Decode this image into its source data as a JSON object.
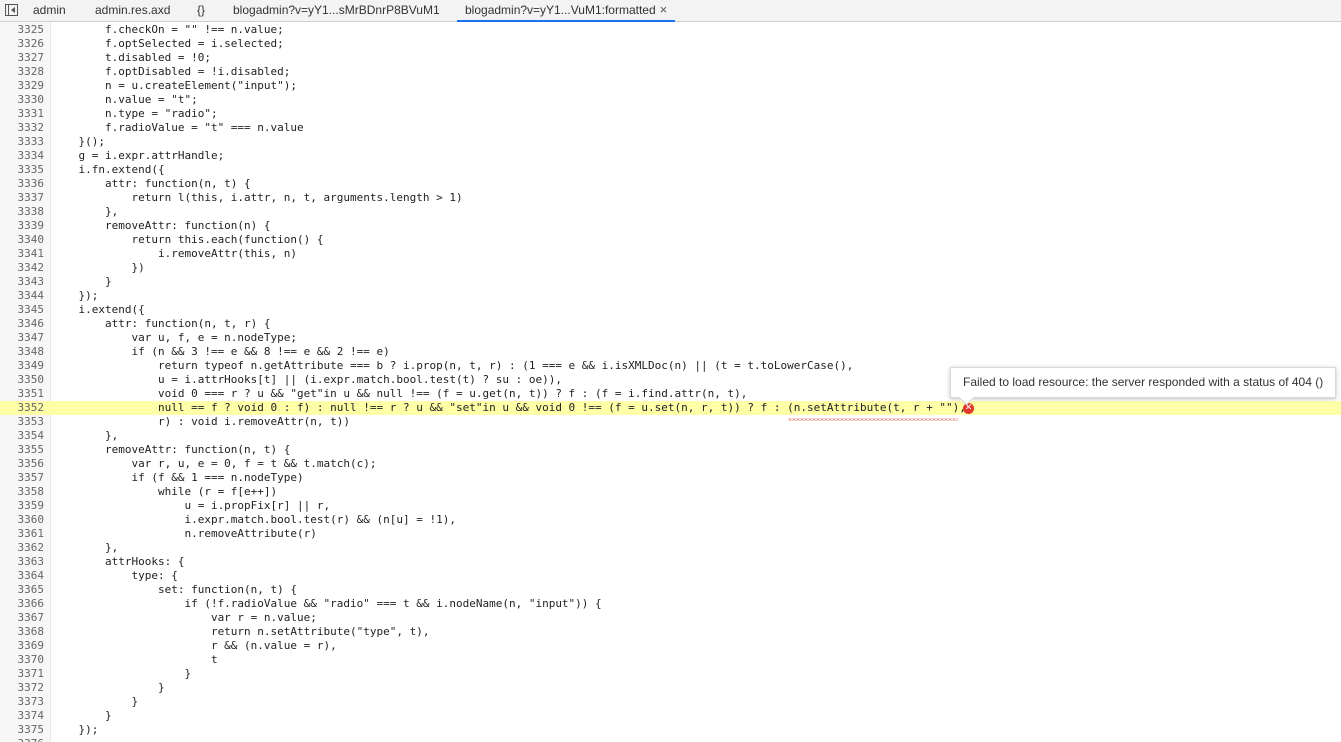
{
  "tabs": [
    {
      "label": "admin",
      "active": false
    },
    {
      "label": "admin.res.axd",
      "active": false
    },
    {
      "label": "{}",
      "active": false
    },
    {
      "label": "blogadmin?v=yY1...sMrBDnrP8BVuM1",
      "active": false
    },
    {
      "label": "blogadmin?v=yY1...VuM1:formatted",
      "active": true
    }
  ],
  "close_glyph": "×",
  "error": {
    "message": "Failed to load resource: the server responded with a status of 404 ()",
    "line": "3352"
  },
  "highlight_color": "#ffffa8",
  "error_color": "#e0392b",
  "lines": [
    {
      "n": "3325",
      "t": "        f.checkOn = \"\" !== n.value;"
    },
    {
      "n": "3326",
      "t": "        f.optSelected = i.selected;"
    },
    {
      "n": "3327",
      "t": "        t.disabled = !0;"
    },
    {
      "n": "3328",
      "t": "        f.optDisabled = !i.disabled;"
    },
    {
      "n": "3329",
      "t": "        n = u.createElement(\"input\");"
    },
    {
      "n": "3330",
      "t": "        n.value = \"t\";"
    },
    {
      "n": "3331",
      "t": "        n.type = \"radio\";"
    },
    {
      "n": "3332",
      "t": "        f.radioValue = \"t\" === n.value"
    },
    {
      "n": "3333",
      "t": "    }();"
    },
    {
      "n": "3334",
      "t": "    g = i.expr.attrHandle;"
    },
    {
      "n": "3335",
      "t": "    i.fn.extend({"
    },
    {
      "n": "3336",
      "t": "        attr: function(n, t) {"
    },
    {
      "n": "3337",
      "t": "            return l(this, i.attr, n, t, arguments.length > 1)"
    },
    {
      "n": "3338",
      "t": "        },"
    },
    {
      "n": "3339",
      "t": "        removeAttr: function(n) {"
    },
    {
      "n": "3340",
      "t": "            return this.each(function() {"
    },
    {
      "n": "3341",
      "t": "                i.removeAttr(this, n)"
    },
    {
      "n": "3342",
      "t": "            })"
    },
    {
      "n": "3343",
      "t": "        }"
    },
    {
      "n": "3344",
      "t": "    });"
    },
    {
      "n": "3345",
      "t": "    i.extend({"
    },
    {
      "n": "3346",
      "t": "        attr: function(n, t, r) {"
    },
    {
      "n": "3347",
      "t": "            var u, f, e = n.nodeType;"
    },
    {
      "n": "3348",
      "t": "            if (n && 3 !== e && 8 !== e && 2 !== e)"
    },
    {
      "n": "3349",
      "t": "                return typeof n.getAttribute === b ? i.prop(n, t, r) : (1 === e && i.isXMLDoc(n) || (t = t.toLowerCase(),"
    },
    {
      "n": "3350",
      "t": "                u = i.attrHooks[t] || (i.expr.match.bool.test(t) ? su : oe)),"
    },
    {
      "n": "3351",
      "t": "                void 0 === r ? u && \"get\"in u && null !== (f = u.get(n, t)) ? f : (f = i.find.attr(n, t),"
    },
    {
      "n": "3352",
      "t": "                null == f ? void 0 : f) : null !== r ? u && \"set\"in u && void 0 !== (f = u.set(n, r, t)) ? f : (n.setAttribute(t, r + \"\"),"
    },
    {
      "n": "3353",
      "t": "                r) : void i.removeAttr(n, t))"
    },
    {
      "n": "3354",
      "t": "        },"
    },
    {
      "n": "3355",
      "t": "        removeAttr: function(n, t) {"
    },
    {
      "n": "3356",
      "t": "            var r, u, e = 0, f = t && t.match(c);"
    },
    {
      "n": "3357",
      "t": "            if (f && 1 === n.nodeType)"
    },
    {
      "n": "3358",
      "t": "                while (r = f[e++])"
    },
    {
      "n": "3359",
      "t": "                    u = i.propFix[r] || r,"
    },
    {
      "n": "3360",
      "t": "                    i.expr.match.bool.test(r) && (n[u] = !1),"
    },
    {
      "n": "3361",
      "t": "                    n.removeAttribute(r)"
    },
    {
      "n": "3362",
      "t": "        },"
    },
    {
      "n": "3363",
      "t": "        attrHooks: {"
    },
    {
      "n": "3364",
      "t": "            type: {"
    },
    {
      "n": "3365",
      "t": "                set: function(n, t) {"
    },
    {
      "n": "3366",
      "t": "                    if (!f.radioValue && \"radio\" === t && i.nodeName(n, \"input\")) {"
    },
    {
      "n": "3367",
      "t": "                        var r = n.value;"
    },
    {
      "n": "3368",
      "t": "                        return n.setAttribute(\"type\", t),"
    },
    {
      "n": "3369",
      "t": "                        r && (n.value = r),"
    },
    {
      "n": "3370",
      "t": "                        t"
    },
    {
      "n": "3371",
      "t": "                    }"
    },
    {
      "n": "3372",
      "t": "                }"
    },
    {
      "n": "3373",
      "t": "            }"
    },
    {
      "n": "3374",
      "t": "        }"
    },
    {
      "n": "3375",
      "t": "    });"
    },
    {
      "n": "3376",
      "t": "    ..."
    }
  ]
}
